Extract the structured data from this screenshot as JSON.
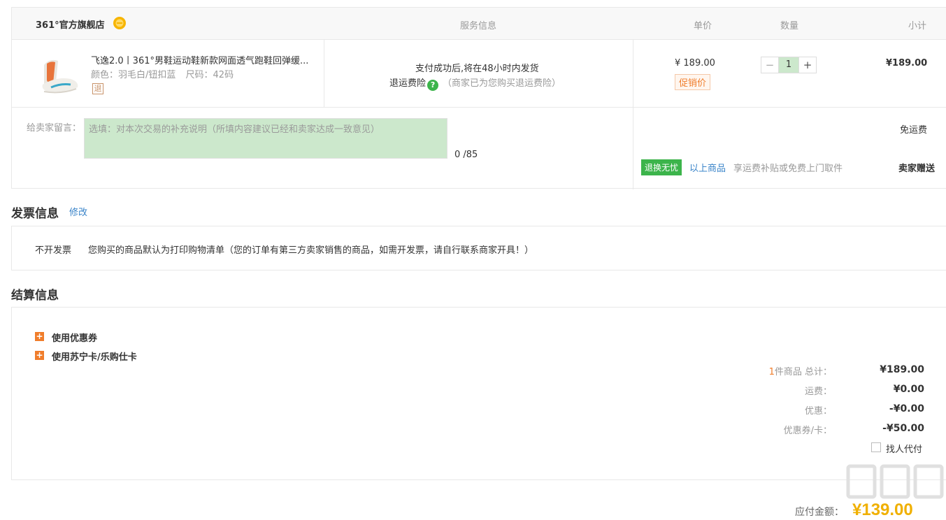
{
  "order": {
    "shop_name": "361°官方旗舰店",
    "headers": {
      "service": "服务信息",
      "unit_price": "单价",
      "quantity": "数量",
      "subtotal": "小计"
    },
    "item": {
      "title": "飞逸2.0丨361°男鞋运动鞋新款网面透气跑鞋回弹缓...",
      "color_label": "颜色：羽毛白/钮扣蓝",
      "size_label": "尺码：42码",
      "return_badge": "退",
      "service_line1": "支付成功后,将在48小时内发货",
      "service_insurance": "退运费险",
      "service_help": "?",
      "service_note": "（商家已为您购买退运费险）",
      "price": "¥ 189.00",
      "promo_tag": "促销价",
      "qty_minus": "−",
      "qty_value": "1",
      "qty_plus": "+",
      "subtotal": "¥189.00"
    },
    "message": {
      "label": "给卖家留言：",
      "placeholder": "选填：对本次交易的补充说明（所填内容建议已经和卖家达成一致意见）",
      "count": "0 /85"
    },
    "shipping": "免运费",
    "return_badge": "退换无忧",
    "return_link": "以上商品",
    "return_desc": "享运费补贴或免费上门取件",
    "seller_gift": "卖家赠送"
  },
  "invoice": {
    "title": "发票信息",
    "edit": "修改",
    "type": "不开发票",
    "desc": "您购买的商品默认为打印购物清单（您的订单有第三方卖家销售的商品，如需开发票，请自行联系商家开具！）"
  },
  "settlement": {
    "title": "结算信息",
    "plus_glyph": "+",
    "options": [
      "使用优惠券",
      "使用苏宁卡/乐购仕卡"
    ],
    "summary": {
      "count": "1",
      "count_suffix": "件商品 总计：",
      "total": "¥189.00",
      "freight_label": "运费：",
      "freight": "¥0.00",
      "discount_label": "优惠：",
      "discount": "-¥0.00",
      "coupon_label": "优惠券/卡：",
      "coupon": "-¥50.00"
    },
    "pay_for_me": "找人代付",
    "payable_label": "应付金额：",
    "payable_value": "¥139.00"
  },
  "colors": {
    "accent_orange": "#f07d2b",
    "link_blue": "#3a84c9",
    "green_badge": "#3cb44b",
    "input_bg": "#cce8cc"
  },
  "icons": [
    "shop-badge-icon",
    "help-icon",
    "plus-icon",
    "checkbox-icon"
  ]
}
